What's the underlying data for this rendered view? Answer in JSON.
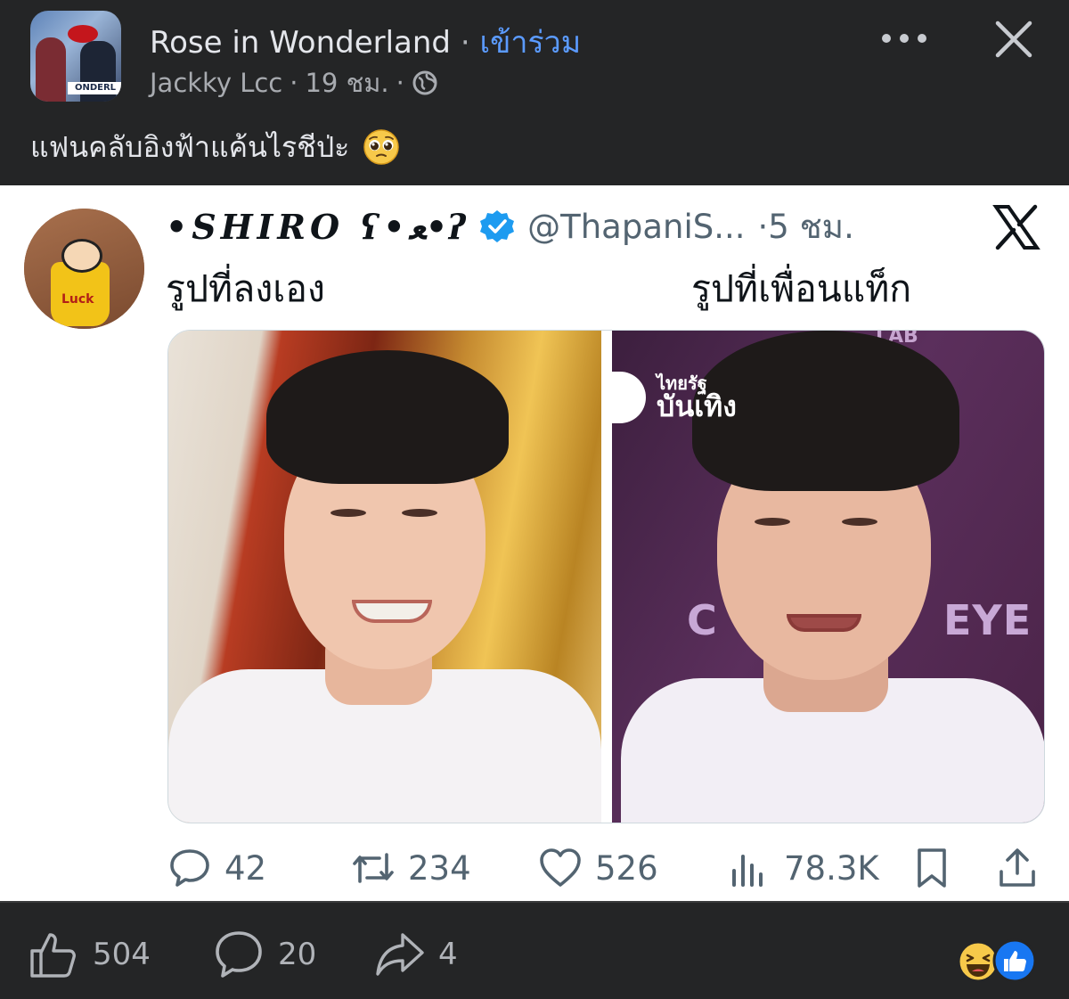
{
  "post": {
    "group_name": "Rose in Wonderland",
    "separator": " · ",
    "join_label": "เข้าร่วม",
    "author": "Jackky Lcc",
    "time": "19 ชม.",
    "sub_separator": "·",
    "text": "แฟนคลับอิงฟ้าแค้นไรชีป่ะ",
    "avatar_banner": "ONDERL"
  },
  "tweet": {
    "display_name": "•SHIRO ʕ•ﻌ•ʔ",
    "handle": "@ThapaniS...",
    "time": "·5 ชม.",
    "avatar_text": "Luck",
    "caption_left": "รูปที่ลงเอง",
    "caption_right": "รูปที่เพื่อนแท็ก",
    "photo_right": {
      "logo_small": "ไทยรัฐ",
      "logo_big": "บันเทิง",
      "bg_text_left": "C",
      "bg_text_right": "EYE",
      "bg_text_top": "LAB"
    },
    "stats": {
      "replies": "42",
      "retweets": "234",
      "likes": "526",
      "views": "78.3K"
    }
  },
  "footer": {
    "likes": "504",
    "comments": "20",
    "shares": "4"
  },
  "colors": {
    "fb_bg": "#242526",
    "link_blue": "#5b9bff",
    "verified_blue": "#1d9bf0",
    "tweet_text": "#0f1419",
    "tweet_muted": "#536471"
  }
}
